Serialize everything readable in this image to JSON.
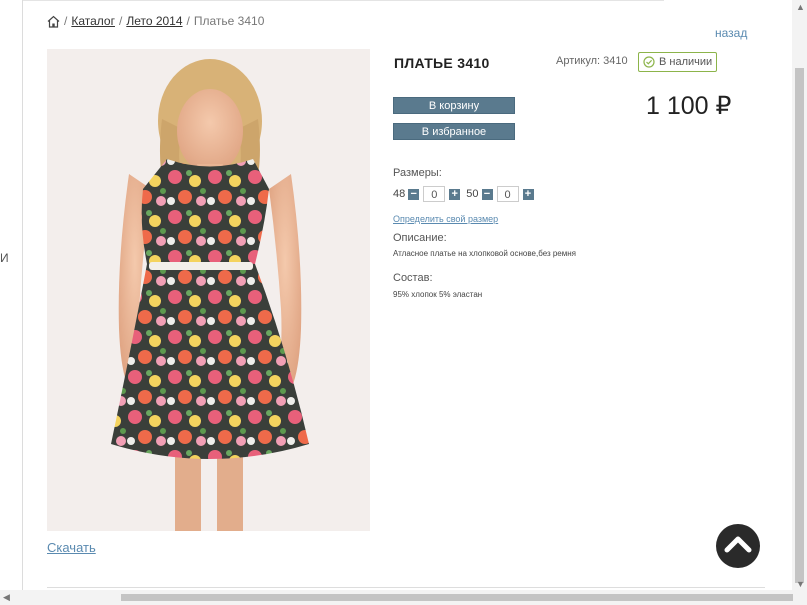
{
  "breadcrumb": {
    "items": [
      "Каталог",
      "Лето 2014"
    ],
    "current": "Платье 3410",
    "separator": "/"
  },
  "back_label": "назад",
  "product": {
    "title": "ПЛАТЬЕ 3410",
    "sku": "Артикул: 3410",
    "stock": "В наличии",
    "price": "1 100 ₽",
    "cart_button": "В корзину",
    "favorite_button": "В избранное",
    "sizes_label": "Размеры:",
    "sizes": [
      {
        "size": "48",
        "qty": "0"
      },
      {
        "size": "50",
        "qty": "0"
      }
    ],
    "size_link": "Определить свой размер",
    "description_label": "Описание:",
    "description": "Атласное платье на хлопковой основе,без ремня",
    "composition_label": "Состав:",
    "composition": "95% хлопок 5% эластан"
  },
  "download_label": "Скачать",
  "left_edge_letter": "И",
  "colors": {
    "accent": "#5a7a8e",
    "link": "#5a8ab0",
    "stock_border": "#8cb44a",
    "scroll_top_bg": "#2a2a2a"
  },
  "icons": [
    "home-icon",
    "check-circle-icon",
    "minus-icon",
    "plus-icon",
    "chevron-up-icon"
  ]
}
